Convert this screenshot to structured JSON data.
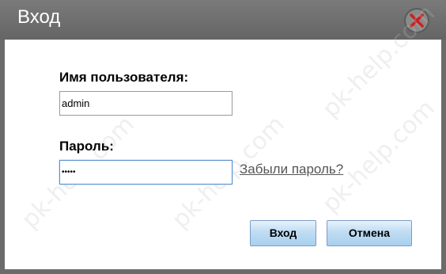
{
  "dialog": {
    "title": "Вход",
    "close_icon": "close-icon",
    "close_color": "#cc1f1f"
  },
  "form": {
    "username_label": "Имя пользователя:",
    "username_value": "admin",
    "password_label": "Пароль:",
    "password_value": "•••••",
    "forgot_link": "Забыли пароль?"
  },
  "buttons": {
    "login_label": "Вход",
    "cancel_label": "Отмена"
  },
  "watermark": {
    "text": "pk-help.com"
  },
  "colors": {
    "titlebar": "#6b6b6b",
    "button_gradient_top": "#e6f2fc",
    "button_gradient_bottom": "#a8d0ee",
    "focus_border": "#5b8ed0"
  }
}
